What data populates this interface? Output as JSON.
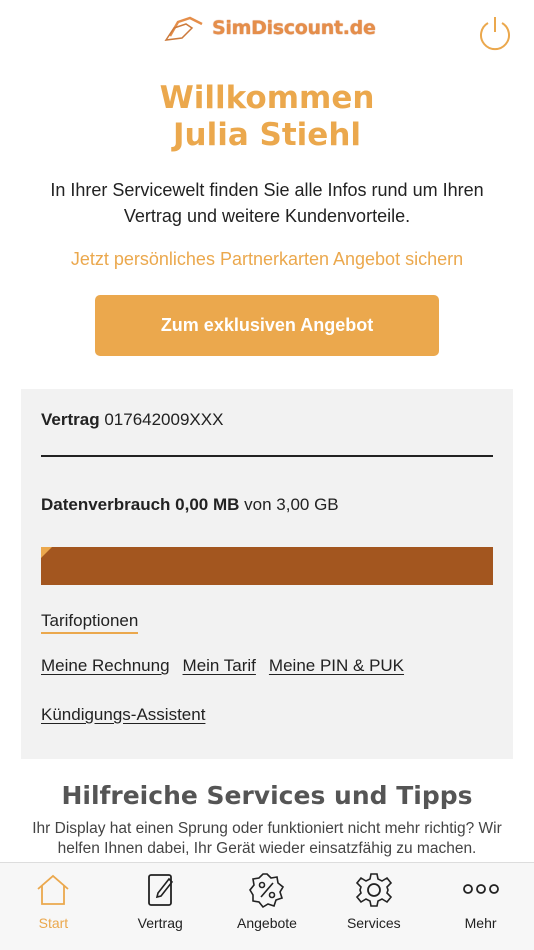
{
  "brand": {
    "logo_text": "SimDiscount.de",
    "accent": "#eba84d",
    "bar_color": "#a3561f"
  },
  "welcome": {
    "line1": "Willkommen",
    "line2": "Julia Stiehl"
  },
  "intro": "In Ihrer Servicewelt finden Sie alle Infos rund um Ihren Vertrag und weitere Kundenvorteile.",
  "partner_link": "Jetzt persönliches Partnerkarten Angebot sichern",
  "cta_label": "Zum exklusiven Angebot",
  "contract": {
    "label": "Vertrag",
    "number": "017642009XXX"
  },
  "usage": {
    "label": "Datenverbrauch 0,00 MB",
    "suffix": "von 3,00 GB",
    "used_fraction": 0.0
  },
  "links": {
    "tarifoptionen": "Tarifoptionen",
    "rechnung": "Meine Rechnung",
    "tarif": "Mein Tarif",
    "pin_puk": "Meine PIN & PUK",
    "kuendigung": "Kündigungs-Assistent"
  },
  "services": {
    "title": "Hilfreiche Services und Tipps",
    "text": "Ihr Display hat einen Sprung oder funktioniert nicht mehr richtig? Wir helfen Ihnen dabei, Ihr Gerät wieder einsatzfähig zu machen."
  },
  "tabs": [
    {
      "label": "Start",
      "icon": "home-icon",
      "active": true
    },
    {
      "label": "Vertrag",
      "icon": "contract-icon",
      "active": false
    },
    {
      "label": "Angebote",
      "icon": "percent-badge-icon",
      "active": false
    },
    {
      "label": "Services",
      "icon": "gear-icon",
      "active": false
    },
    {
      "label": "Mehr",
      "icon": "more-dots-icon",
      "active": false
    }
  ]
}
